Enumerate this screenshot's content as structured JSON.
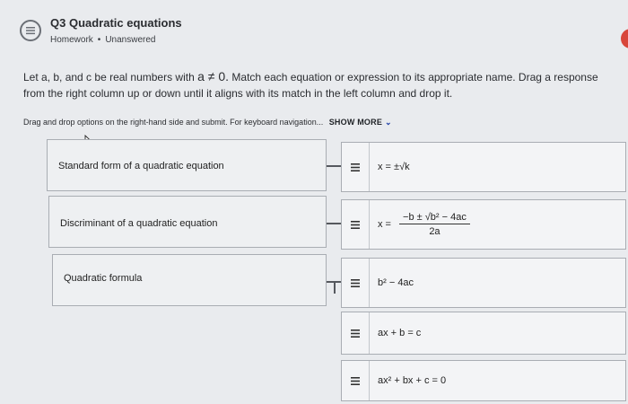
{
  "header": {
    "title": "Q3 Quadratic equations",
    "homework": "Homework",
    "separator": "•",
    "status": "Unanswered"
  },
  "prompt": {
    "text_before": "Let a, b, and c be real numbers with",
    "math": "a ≠ 0.",
    "text_after": "Match each equation or expression to its appropriate name. Drag a response from the right column up or down until it aligns with its match in the left column and drop it."
  },
  "hint": {
    "text": "Drag and drop options on the right-hand side and submit. For keyboard navigation...",
    "show_more": "SHOW MORE"
  },
  "left_items": [
    {
      "label": "Standard form of a quadratic equation"
    },
    {
      "label": "Discriminant of a quadratic equation"
    },
    {
      "label": "Quadratic formula"
    }
  ],
  "right_items": [
    {
      "text": "x = ±√k"
    },
    {
      "prefix": "x =",
      "numerator": "−b ± √b² − 4ac",
      "denominator": "2a"
    },
    {
      "text": "b² − 4ac"
    },
    {
      "text": "ax + b = c"
    },
    {
      "text": "ax² + bx + c = 0"
    }
  ],
  "icons": {
    "question": "question-list-icon",
    "grip": "drag-handle-icon",
    "chevron": "chevron-down-icon",
    "cursor": "mouse-cursor-icon"
  },
  "colors": {
    "background": "#e9ebee",
    "accent": "#d8453a",
    "link": "#1f3fa6"
  }
}
